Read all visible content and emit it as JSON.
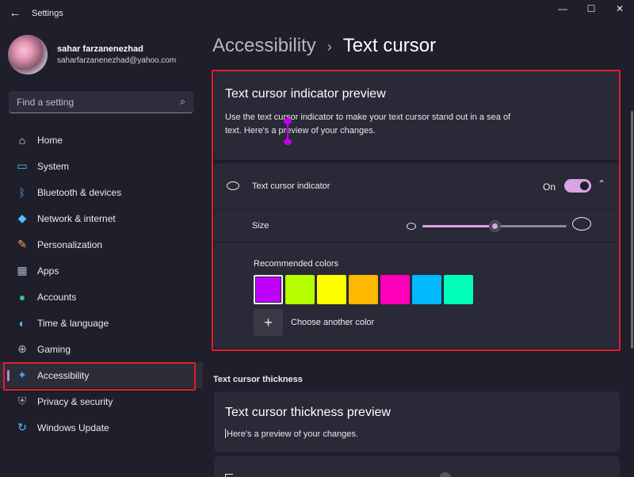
{
  "window": {
    "title": "Settings",
    "minimize_glyph": "—",
    "maximize_glyph": "☐",
    "close_glyph": "✕",
    "back_glyph": "←"
  },
  "profile": {
    "name": "sahar farzanenezhad",
    "email": "saharfarzanenezhad@yahoo.com"
  },
  "search": {
    "placeholder": "Find a setting",
    "icon": "⌕"
  },
  "nav": {
    "items": [
      {
        "label": "Home",
        "icon": "⌂"
      },
      {
        "label": "System",
        "icon": "▭"
      },
      {
        "label": "Bluetooth & devices",
        "icon": "ᛒ"
      },
      {
        "label": "Network & internet",
        "icon": "◆"
      },
      {
        "label": "Personalization",
        "icon": "✎"
      },
      {
        "label": "Apps",
        "icon": "▦"
      },
      {
        "label": "Accounts",
        "icon": "●"
      },
      {
        "label": "Time & language",
        "icon": "◐"
      },
      {
        "label": "Gaming",
        "icon": "⊕"
      },
      {
        "label": "Accessibility",
        "icon": "✦"
      },
      {
        "label": "Privacy & security",
        "icon": "⛨"
      },
      {
        "label": "Windows Update",
        "icon": "↻"
      }
    ],
    "active_index": 9
  },
  "breadcrumb": {
    "parent": "Accessibility",
    "separator": "›",
    "current": "Text cursor"
  },
  "preview": {
    "title": "Text cursor indicator preview",
    "description": "Use the text cursor indicator to make your text cursor stand out in a sea of text. Here's a preview of your changes."
  },
  "indicator": {
    "label": "Text cursor indicator",
    "state": "On",
    "chevron": "⌃"
  },
  "size": {
    "label": "Size",
    "value_fraction": 0.5
  },
  "colors": {
    "label": "Recommended colors",
    "swatches": [
      "#bf00ff",
      "#b5ff00",
      "#ffff00",
      "#ffb900",
      "#ff00b9",
      "#00b9ff",
      "#00ffb9"
    ],
    "selected_index": 0,
    "add_label": "Choose another color",
    "add_glyph": "+"
  },
  "thickness": {
    "section_heading": "Text cursor thickness",
    "title": "Text cursor thickness preview",
    "description": "Here's a preview of your changes."
  },
  "accent_color": "#d9a4e4",
  "highlight_color": "#e0202a"
}
